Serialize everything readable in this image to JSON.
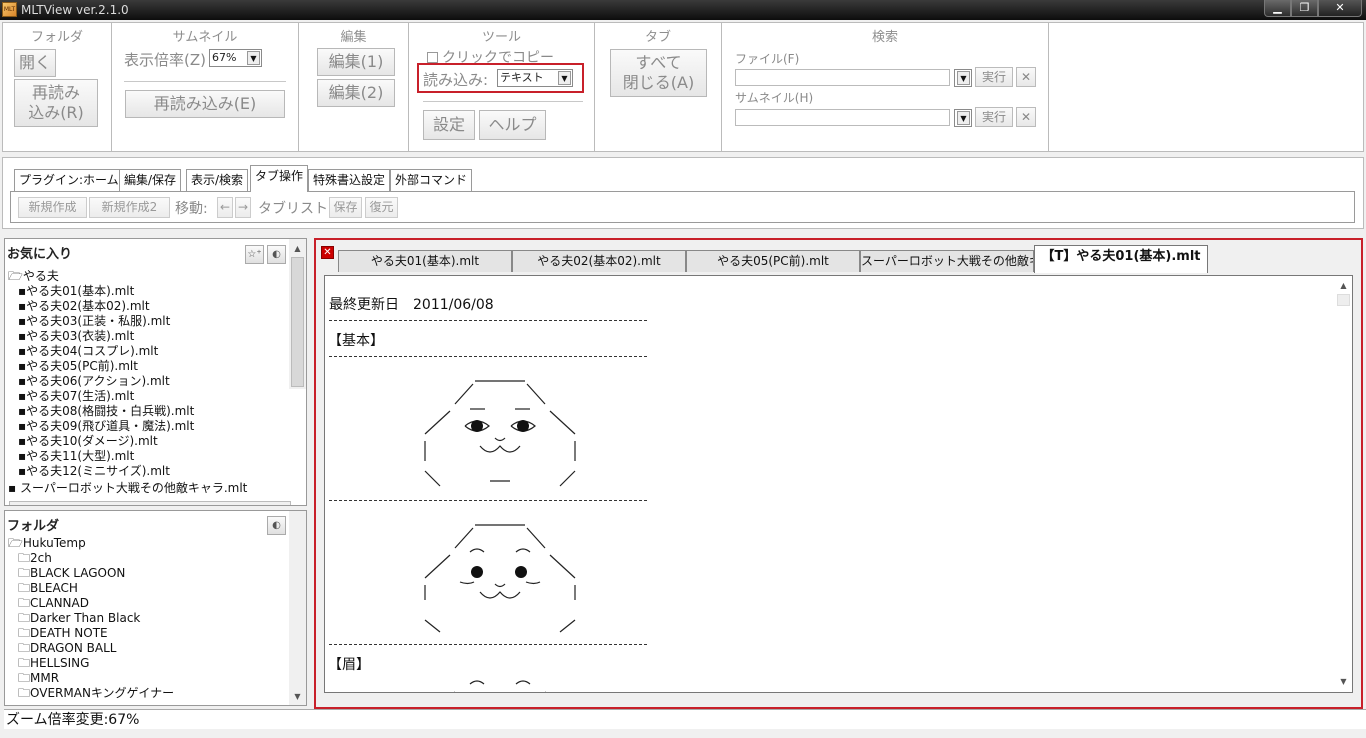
{
  "window": {
    "title": "MLTView ver.2.1.0",
    "icon_text": "MLT"
  },
  "ribbon": {
    "folder": {
      "title": "フォルダ",
      "open": "開く",
      "reload": "再読み\n込み(R)"
    },
    "thumbnail": {
      "title": "サムネイル",
      "zoom_label": "表示倍率(Z)",
      "zoom_value": "67%",
      "reload": "再読み込み(E)"
    },
    "edit": {
      "title": "編集",
      "edit1": "編集(1)",
      "edit2": "編集(2)"
    },
    "tool": {
      "title": "ツール",
      "click_copy": "クリックでコピー",
      "load_label": "読み込み:",
      "load_value": "テキスト",
      "settings": "設定",
      "help": "ヘルプ"
    },
    "tab": {
      "title": "タブ",
      "close_all": "すべて\n閉じる(A)"
    },
    "search": {
      "title": "検索",
      "file_label": "ファイル(F)",
      "thumb_label": "サムネイル(H)",
      "run": "実行",
      "clear": "✕"
    }
  },
  "plugin_tabs": [
    "プラグイン:ホーム",
    "編集/保存",
    "表示/検索",
    "タブ操作",
    "特殊書込設定",
    "外部コマンド"
  ],
  "plugin_active": "タブ操作",
  "tab_ops": {
    "new": "新規作成",
    "new2": "新規作成2",
    "move_label": "移動:",
    "left": "←",
    "right": "→",
    "tablist_label": "タブリスト:",
    "save": "保存",
    "restore": "復元"
  },
  "favorites": {
    "title": "お気に入り",
    "root": "やる夫",
    "items": [
      "やる夫01(基本).mlt",
      "やる夫02(基本02).mlt",
      "やる夫03(正装・私服).mlt",
      "やる夫03(衣装).mlt",
      "やる夫04(コスプレ).mlt",
      "やる夫05(PC前).mlt",
      "やる夫06(アクション).mlt",
      "やる夫07(生活).mlt",
      "やる夫08(格闘技・白兵戦).mlt",
      "やる夫09(飛び道具・魔法).mlt",
      "やる夫10(ダメージ).mlt",
      "やる夫11(大型).mlt",
      "やる夫12(ミニサイズ).mlt"
    ],
    "extra": "スーパーロボット大戦その他敵キャラ.mlt"
  },
  "folders": {
    "title": "フォルダ",
    "root": "HukuTemp",
    "items": [
      "2ch",
      "BLACK LAGOON",
      "BLEACH",
      "CLANNAD",
      "Darker Than Black",
      "DEATH NOTE",
      "DRAGON BALL",
      "HELLSING",
      "MMR",
      "OVERMANキングゲイナー"
    ]
  },
  "viewer": {
    "tabs": [
      "やる夫01(基本).mlt",
      "やる夫02(基本02).mlt",
      "やる夫05(PC前).mlt",
      "スーパーロボット大戦その他敵キャラ",
      "【T】やる夫01(基本).mlt"
    ],
    "active_tab": "【T】やる夫01(基本).mlt",
    "updated": "最終更新日　2011/06/08",
    "section1": "【基本】",
    "section2": "【眉】"
  },
  "status": {
    "text": "ズーム倍率変更:67%"
  },
  "colors": {
    "highlight": "#c8202a",
    "titlebar": "#1a1a1a"
  }
}
